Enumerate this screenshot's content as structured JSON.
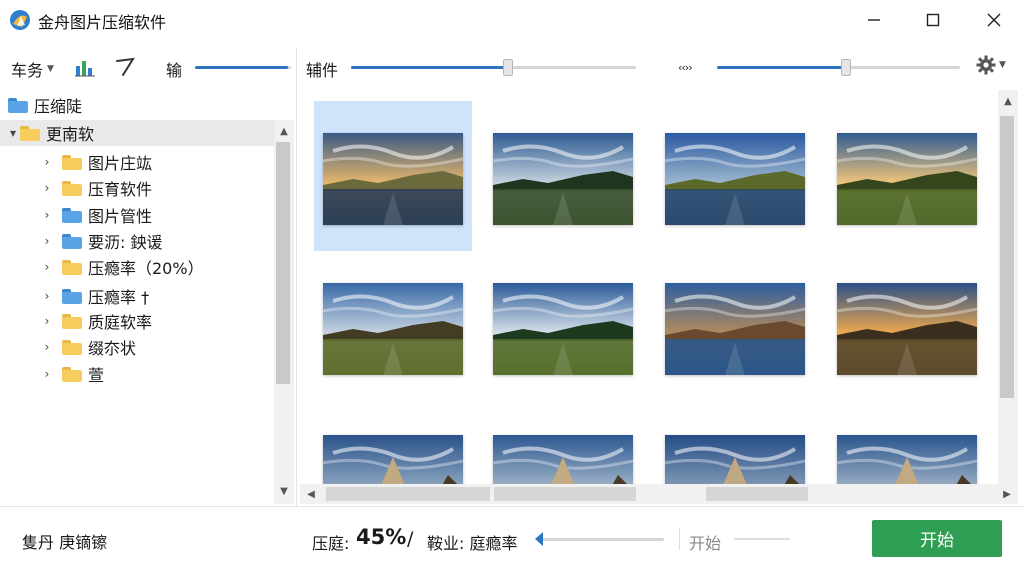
{
  "window": {
    "title": "金舟图片压缩软件",
    "controls": {
      "minimize": "—",
      "maximize": "☐",
      "close": "✕"
    }
  },
  "toolbar": {
    "task_label": "车务",
    "label_short": "输",
    "slider1_label": "辅件",
    "slider1_value": 0.55,
    "slider2_label": "‹‹››",
    "slider2_value": 0.53,
    "mini_slider_value": 0.97,
    "settings_icon": "gear-icon"
  },
  "tree": {
    "items": [
      {
        "label": "压缩陡",
        "color": "blue",
        "level": 0,
        "expand": "",
        "selected": false
      },
      {
        "label": "更南软",
        "color": "yellow",
        "level": 0,
        "expand": "▾",
        "selected": true
      },
      {
        "label": "图片庄竑",
        "color": "yellow",
        "level": 1,
        "expand": "›",
        "selected": false
      },
      {
        "label": "压育软件",
        "color": "yellow",
        "level": 1,
        "expand": "›",
        "selected": false
      },
      {
        "label": "图片管性",
        "color": "blue",
        "level": 1,
        "expand": "›",
        "selected": false
      },
      {
        "label": "要沥: 鉠谖",
        "color": "blue",
        "level": 1,
        "expand": "›",
        "selected": false
      },
      {
        "label": "压瘾率（20%）",
        "color": "yellow",
        "level": 1,
        "expand": "›",
        "selected": false
      },
      {
        "label": "压瘾率 †",
        "color": "blue",
        "level": 1,
        "expand": "›",
        "selected": false
      },
      {
        "label": "质庭软率",
        "color": "yellow",
        "level": 1,
        "expand": "›",
        "selected": false
      },
      {
        "label": "缀夵状",
        "color": "yellow",
        "level": 1,
        "expand": "›",
        "selected": false
      },
      {
        "label": "萱",
        "color": "yellow",
        "level": 1,
        "expand": "›",
        "selected": false
      }
    ],
    "scroll_up": "▲",
    "scroll_down": "▼"
  },
  "grid": {
    "selected_index": 0,
    "images": [
      {
        "name": "lake-pier-sunset",
        "sky": "#3a5a86",
        "horizon": "#e9b76a",
        "ground": "#2c3f56",
        "accent": "#6b6a3c"
      },
      {
        "name": "river-trees",
        "sky": "#2d5a92",
        "horizon": "#c7d4de",
        "ground": "#3c5330",
        "accent": "#1f3520"
      },
      {
        "name": "mountain-lake",
        "sky": "#2b5aa0",
        "horizon": "#9eb7cf",
        "ground": "#2b4a6e",
        "accent": "#5b6a2a"
      },
      {
        "name": "field-sunrise",
        "sky": "#2f5b92",
        "horizon": "#f2c77a",
        "ground": "#4f6a2a",
        "accent": "#35461c"
      },
      {
        "name": "meadow-path",
        "sky": "#3869a6",
        "horizon": "#c9d5e2",
        "ground": "#5e6f2e",
        "accent": "#433d24"
      },
      {
        "name": "pine-valley",
        "sky": "#2b5a99",
        "horizon": "#d9e2ea",
        "ground": "#566f2c",
        "accent": "#1d3a1e"
      },
      {
        "name": "mountain-reflection",
        "sky": "#2d5e9e",
        "horizon": "#b38a5c",
        "ground": "#2c5688",
        "accent": "#6a4a2e"
      },
      {
        "name": "dusk-trail",
        "sky": "#2b4f86",
        "horizon": "#f0a94e",
        "ground": "#5b4a2c",
        "accent": "#3a2f1e"
      },
      {
        "name": "peak-1",
        "sky": "#2a528a",
        "horizon": "#8aa3bd",
        "ground": "#8b6a3e",
        "accent": "#4a3a24"
      },
      {
        "name": "peak-2",
        "sky": "#2d5892",
        "horizon": "#9bb0c4",
        "ground": "#8d6c40",
        "accent": "#4c3b24"
      },
      {
        "name": "peak-3",
        "sky": "#244c86",
        "horizon": "#7f97b3",
        "ground": "#876640",
        "accent": "#473824"
      },
      {
        "name": "peak-4",
        "sky": "#2b558f",
        "horizon": "#97acc1",
        "ground": "#8a6a3f",
        "accent": "#4a3a23"
      }
    ]
  },
  "status": {
    "left_label": "隻丹 庚镝镲",
    "compress_label": "压庭:",
    "compress_pct": "45%",
    "slash": "/",
    "mode_label": "鞍业: 庭瘾率",
    "secondary_label": "开始",
    "start_button": "开始",
    "slider_value": 0.04
  }
}
